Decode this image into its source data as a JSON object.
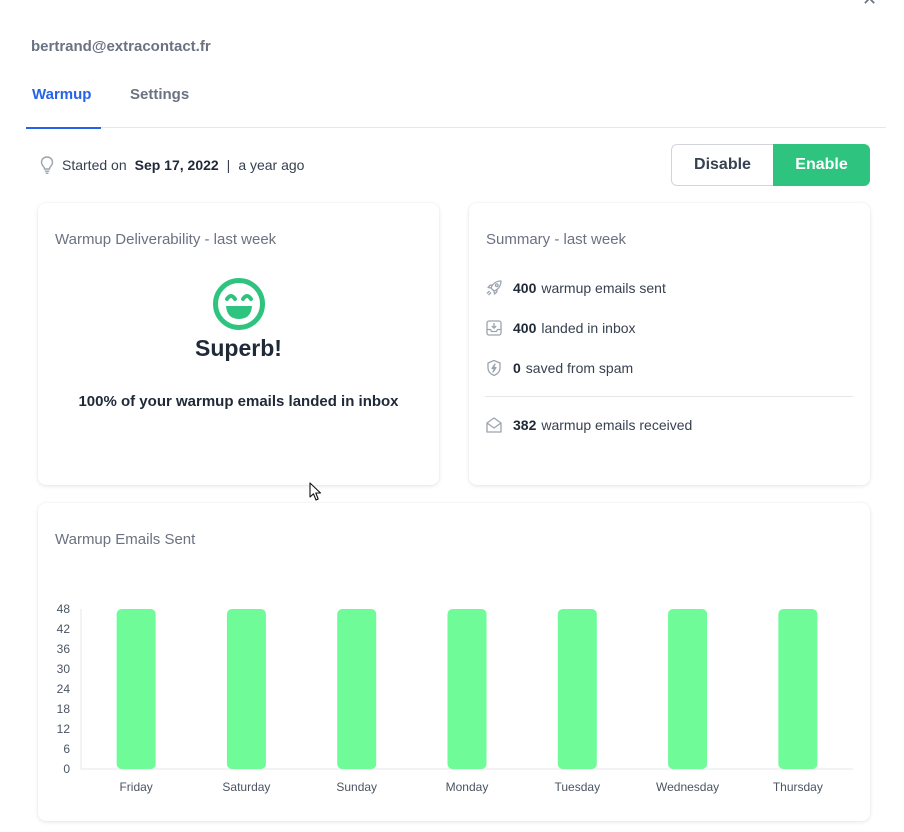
{
  "account_email": "bertrand@extracontact.fr",
  "close_icon": "close-icon",
  "tabs": [
    {
      "label": "Warmup",
      "active": true
    },
    {
      "label": "Settings",
      "active": false
    }
  ],
  "status": {
    "started_label": "Started on",
    "started_date": "Sep 17, 2022",
    "separator": "|",
    "relative_time": "a year ago",
    "icon": "lightbulb-icon"
  },
  "actions": {
    "disable_label": "Disable",
    "enable_label": "Enable",
    "enabled": true
  },
  "deliverability": {
    "title": "Warmup Deliverability - last week",
    "icon": "smiley-icon",
    "verdict": "Superb!",
    "message": "100% of your warmup emails landed in inbox"
  },
  "summary": {
    "title": "Summary - last week",
    "sent": {
      "value": "400",
      "label": "warmup emails sent",
      "icon": "rocket-icon"
    },
    "inbox": {
      "value": "400",
      "label": "landed in inbox",
      "icon": "inbox-icon"
    },
    "spam": {
      "value": "0",
      "label": "saved from spam",
      "icon": "shield-bolt-icon"
    },
    "received": {
      "value": "382",
      "label": "warmup emails received",
      "icon": "envelope-open-icon"
    }
  },
  "colors": {
    "accent": "#2563eb",
    "enable": "#2ec47f",
    "bar": "#6efb98",
    "smiley": "#2ec47f"
  },
  "chart_data": {
    "type": "bar",
    "title": "Warmup Emails Sent",
    "categories": [
      "Friday",
      "Saturday",
      "Sunday",
      "Monday",
      "Tuesday",
      "Wednesday",
      "Thursday"
    ],
    "values": [
      48,
      48,
      48,
      48,
      48,
      48,
      48
    ],
    "yticks": [
      0,
      6,
      12,
      18,
      24,
      30,
      36,
      42,
      48
    ],
    "ylim": [
      0,
      48
    ],
    "grid": false,
    "legend": "none"
  }
}
